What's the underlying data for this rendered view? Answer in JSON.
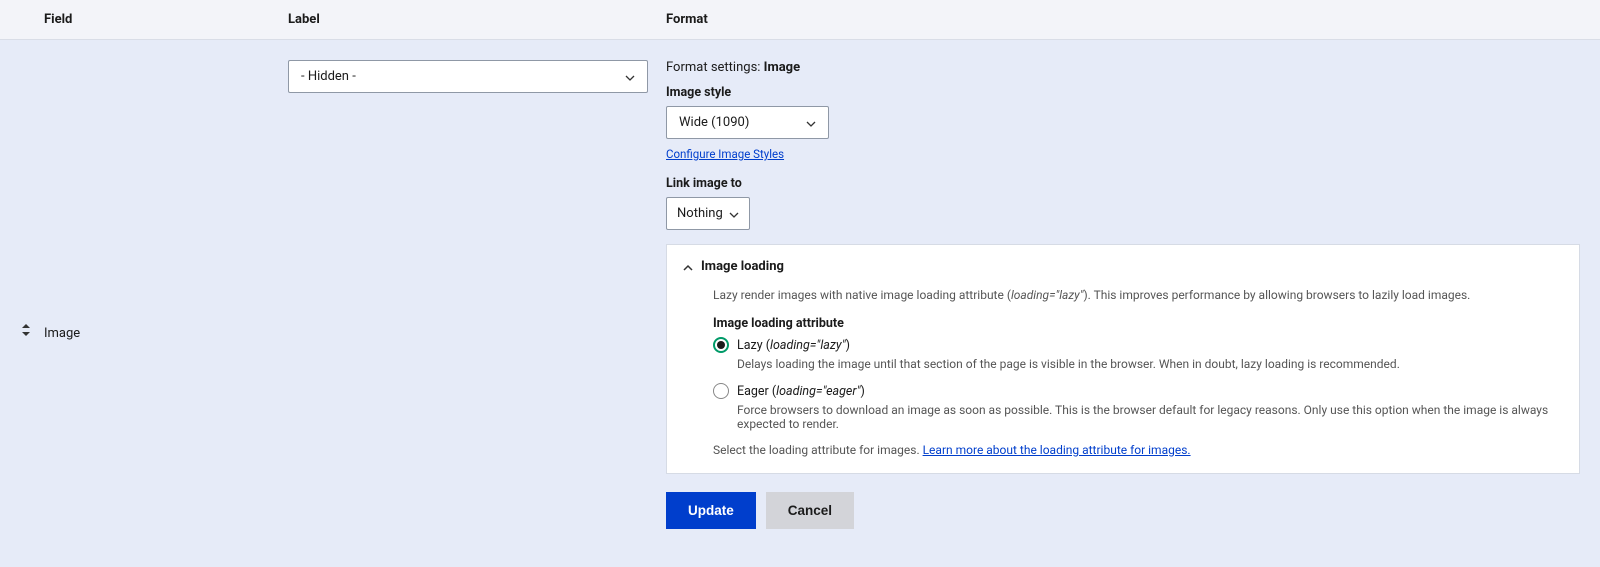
{
  "headers": {
    "field": "Field",
    "label": "Label",
    "format": "Format"
  },
  "row": {
    "drag_icon_name": "drag-handle",
    "field_name": "Image",
    "label_select": "- Hidden -"
  },
  "format": {
    "settings_prefix": "Format settings: ",
    "settings_value": "Image",
    "image_style": {
      "label": "Image style",
      "value": "Wide (1090)",
      "configure_link": "Configure Image Styles"
    },
    "link_image_to": {
      "label": "Link image to",
      "value": "Nothing"
    },
    "loading": {
      "summary": "Image loading",
      "description_pre": "Lazy render images with native image loading attribute (",
      "description_ital": "loading=\"lazy\"",
      "description_post": "). This improves performance by allowing browsers to lazily load images.",
      "attr_label": "Image loading attribute",
      "opt_lazy": {
        "label_pre": "Lazy (",
        "label_ital": "loading=\"lazy\"",
        "label_post": ")",
        "help": "Delays loading the image until that section of the page is visible in the browser. When in doubt, lazy loading is recommended."
      },
      "opt_eager": {
        "label_pre": "Eager (",
        "label_ital": "loading=\"eager\"",
        "label_post": ")",
        "help": "Force browsers to download an image as soon as possible. This is the browser default for legacy reasons. Only use this option when the image is always expected to render."
      },
      "footer_text": "Select the loading attribute for images. ",
      "footer_link": "Learn more about the loading attribute for images."
    }
  },
  "buttons": {
    "update": "Update",
    "cancel": "Cancel"
  }
}
